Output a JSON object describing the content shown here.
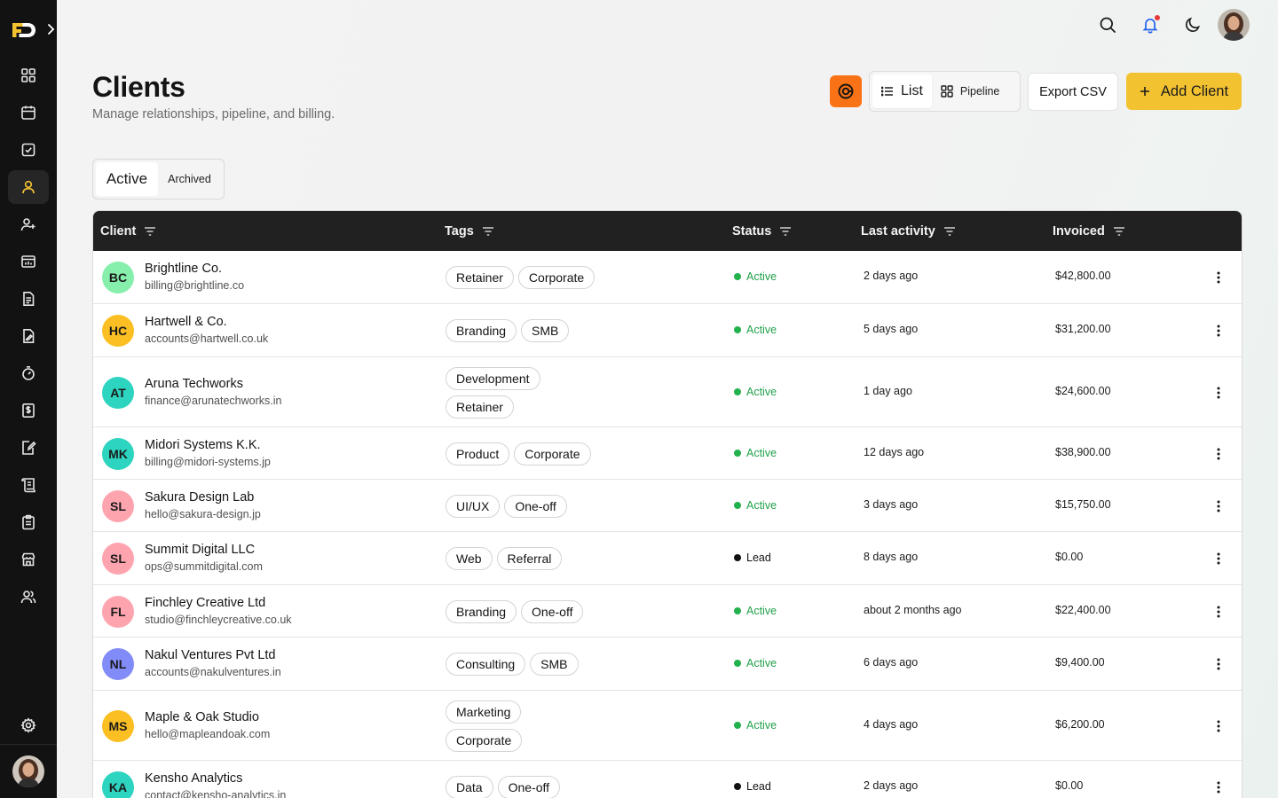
{
  "header": {
    "title": "Clients",
    "subtitle": "Manage relationships, pipeline, and billing."
  },
  "toolbar": {
    "view_list_label": "List",
    "view_pipeline_label": "Pipeline",
    "export_label": "Export CSV",
    "add_label": "Add Client"
  },
  "tabs": [
    {
      "label": "Active",
      "selected": true
    },
    {
      "label": "Archived",
      "selected": false
    }
  ],
  "table": {
    "columns": [
      "Client",
      "Tags",
      "Status",
      "Last activity",
      "Invoiced"
    ],
    "rows": [
      {
        "initials": "BC",
        "avatar_color": "#86efac",
        "name": "Brightline Co.",
        "email": "billing@brightline.co",
        "tags": [
          "Retainer",
          "Corporate"
        ],
        "status": "Active",
        "activity": "2 days ago",
        "invoiced": "$42,800.00"
      },
      {
        "initials": "HC",
        "avatar_color": "#fbbf24",
        "name": "Hartwell & Co.",
        "email": "accounts@hartwell.co.uk",
        "tags": [
          "Branding",
          "SMB"
        ],
        "status": "Active",
        "activity": "5 days ago",
        "invoiced": "$31,200.00"
      },
      {
        "initials": "AT",
        "avatar_color": "#2dd4bf",
        "name": "Aruna Techworks",
        "email": "finance@arunatechworks.in",
        "tags": [
          "Development",
          "Retainer"
        ],
        "status": "Active",
        "activity": "1 day ago",
        "invoiced": "$24,600.00"
      },
      {
        "initials": "MK",
        "avatar_color": "#2dd4bf",
        "name": "Midori Systems K.K.",
        "email": "billing@midori-systems.jp",
        "tags": [
          "Product",
          "Corporate"
        ],
        "status": "Active",
        "activity": "12 days ago",
        "invoiced": "$38,900.00"
      },
      {
        "initials": "SL",
        "avatar_color": "#fda4af",
        "name": "Sakura Design Lab",
        "email": "hello@sakura-design.jp",
        "tags": [
          "UI/UX",
          "One-off"
        ],
        "status": "Active",
        "activity": "3 days ago",
        "invoiced": "$15,750.00"
      },
      {
        "initials": "SL",
        "avatar_color": "#fda4af",
        "name": "Summit Digital LLC",
        "email": "ops@summitdigital.com",
        "tags": [
          "Web",
          "Referral"
        ],
        "status": "Lead",
        "activity": "8 days ago",
        "invoiced": "$0.00"
      },
      {
        "initials": "FL",
        "avatar_color": "#fda4af",
        "name": "Finchley Creative Ltd",
        "email": "studio@finchleycreative.co.uk",
        "tags": [
          "Branding",
          "One-off"
        ],
        "status": "Active",
        "activity": "about 2 months ago",
        "invoiced": "$22,400.00"
      },
      {
        "initials": "NL",
        "avatar_color": "#818cf8",
        "name": "Nakul Ventures Pvt Ltd",
        "email": "accounts@nakulventures.in",
        "tags": [
          "Consulting",
          "SMB"
        ],
        "status": "Active",
        "activity": "6 days ago",
        "invoiced": "$9,400.00"
      },
      {
        "initials": "MS",
        "avatar_color": "#fbbf24",
        "name": "Maple & Oak Studio",
        "email": "hello@mapleandoak.com",
        "tags": [
          "Marketing",
          "Corporate"
        ],
        "status": "Active",
        "activity": "4 days ago",
        "invoiced": "$6,200.00"
      },
      {
        "initials": "KA",
        "avatar_color": "#2dd4bf",
        "name": "Kensho Analytics",
        "email": "contact@kensho-analytics.in",
        "tags": [
          "Data",
          "One-off"
        ],
        "status": "Lead",
        "activity": "2 days ago",
        "invoiced": "$0.00"
      }
    ]
  },
  "colors": {
    "sidebar": "#121212",
    "accent_yellow": "#f2c230",
    "accent_orange": "#f97316",
    "status_active": "#22b14c",
    "table_header": "#212121"
  },
  "icons": {
    "sidebar": [
      "dashboard-icon",
      "calendar-icon",
      "tasks-icon",
      "clients-icon",
      "add-user-icon",
      "projects-icon",
      "documents-icon",
      "proposals-icon",
      "timer-icon",
      "invoices-icon",
      "contracts-icon",
      "ledger-icon",
      "clipboard-icon",
      "store-icon",
      "team-icon",
      "settings-icon"
    ],
    "topbar": [
      "search-icon",
      "bell-icon",
      "moon-icon"
    ]
  }
}
